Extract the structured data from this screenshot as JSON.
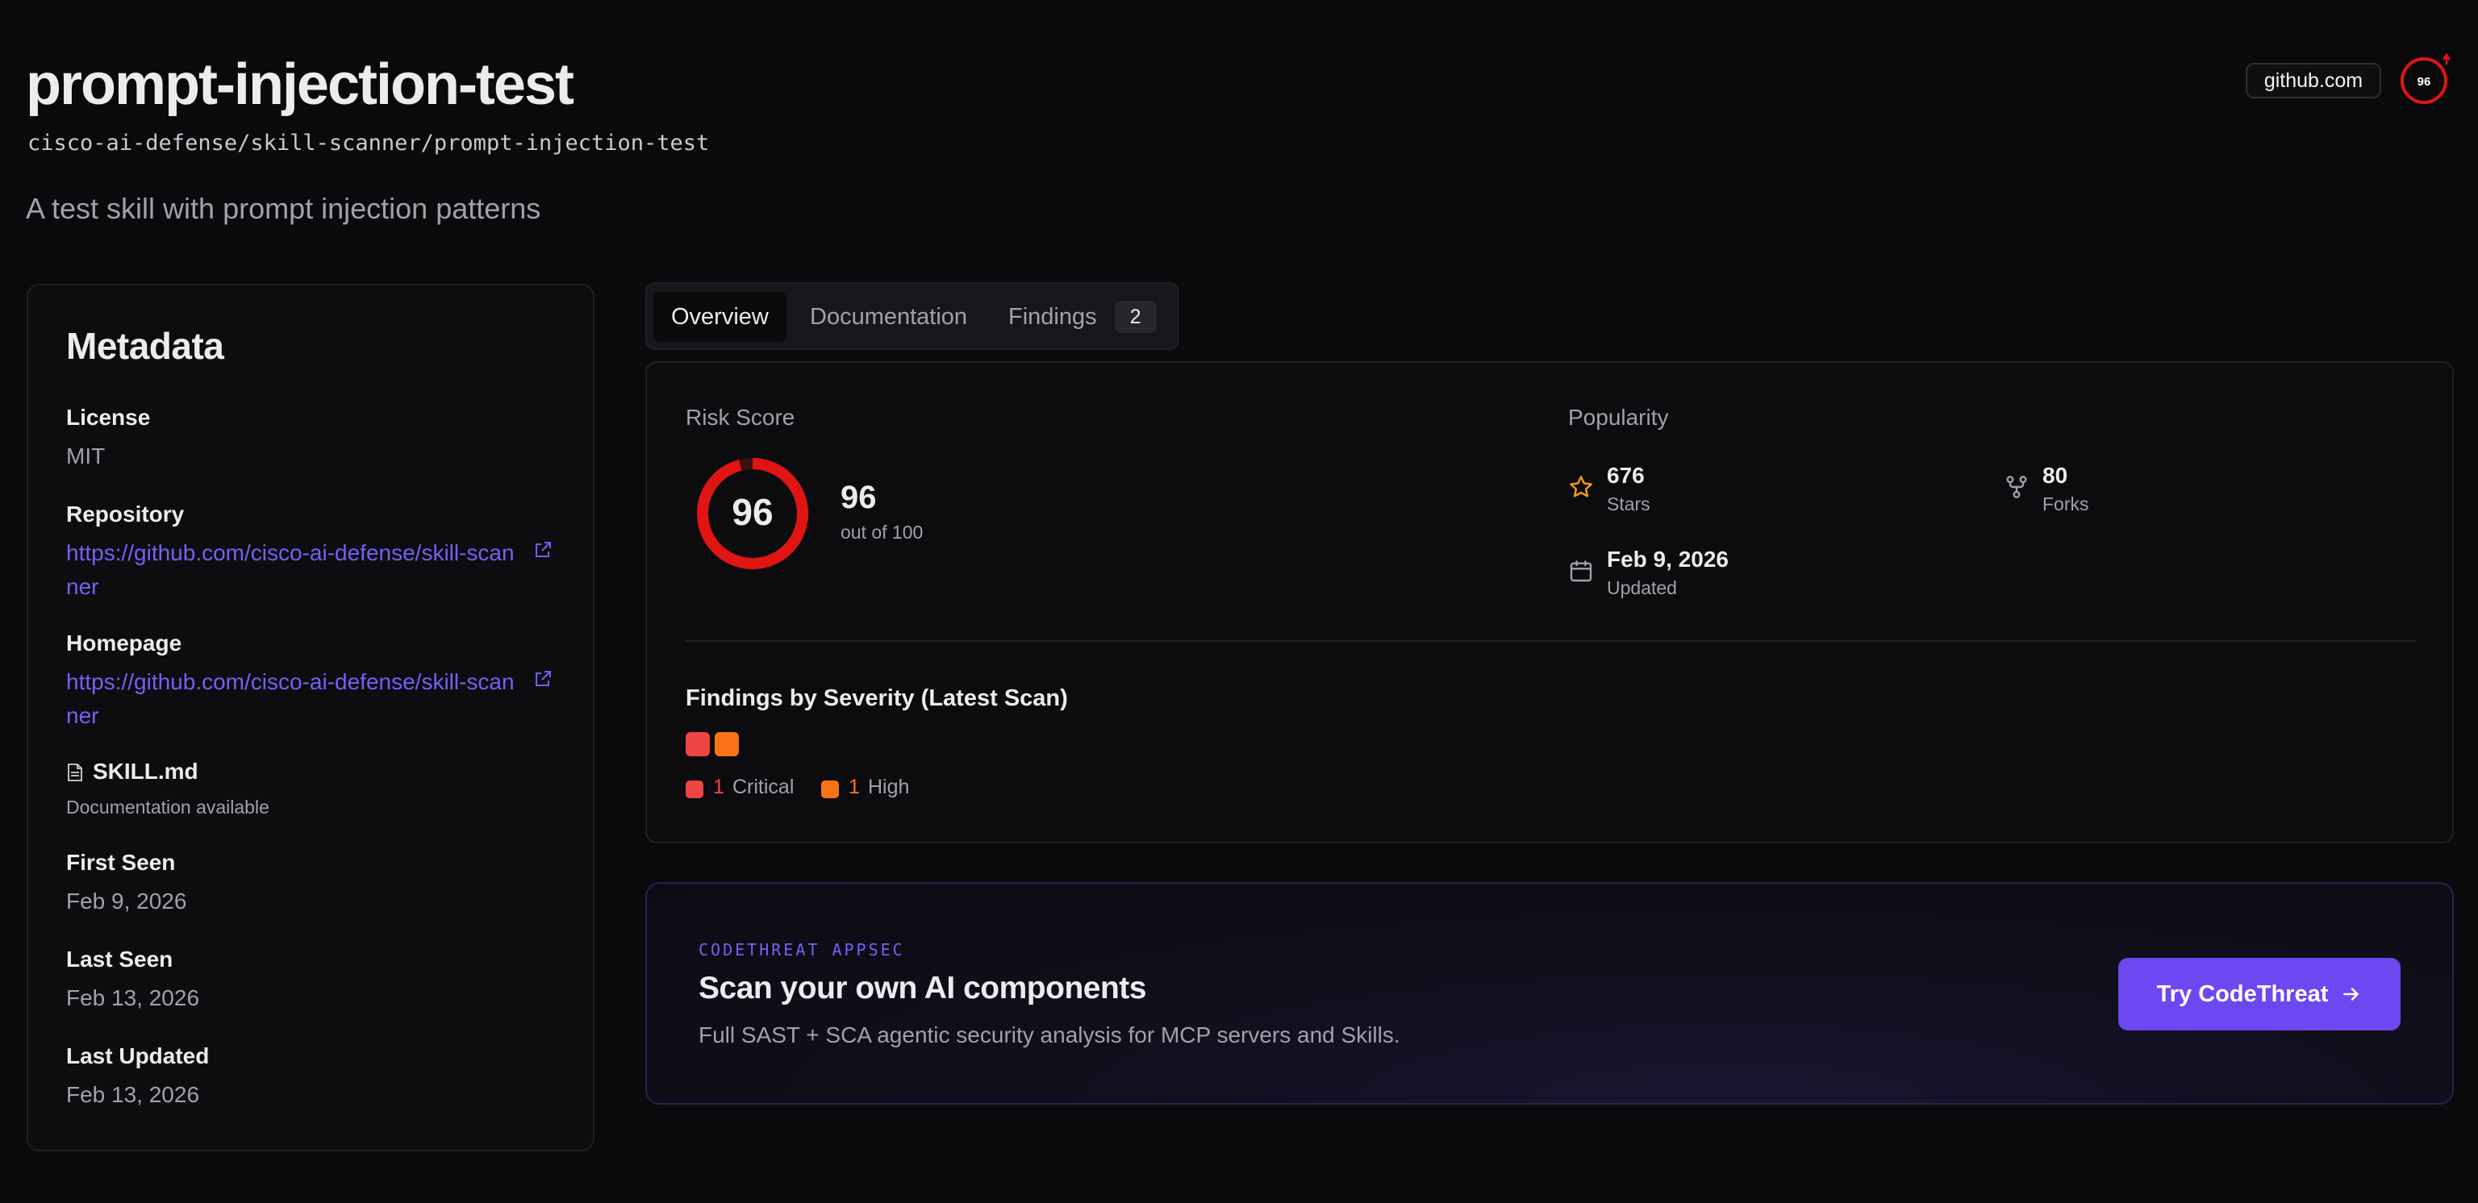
{
  "header": {
    "title": "prompt-injection-test",
    "path": "cisco-ai-defense/skill-scanner/prompt-injection-test",
    "description": "A test skill with prompt injection patterns",
    "source_badge": "github.com",
    "score_badge": "96"
  },
  "metadata": {
    "title": "Metadata",
    "license_label": "License",
    "license_value": "MIT",
    "repository_label": "Repository",
    "repository_url": "https://github.com/cisco-ai-defense/skill-scanner",
    "homepage_label": "Homepage",
    "homepage_url": "https://github.com/cisco-ai-defense/skill-scanner",
    "skill_file": "SKILL.md",
    "skill_file_note": "Documentation available",
    "first_seen_label": "First Seen",
    "first_seen_value": "Feb 9, 2026",
    "last_seen_label": "Last Seen",
    "last_seen_value": "Feb 13, 2026",
    "last_updated_label": "Last Updated",
    "last_updated_value": "Feb 13, 2026"
  },
  "tabs": [
    {
      "label": "Overview",
      "active": true
    },
    {
      "label": "Documentation",
      "active": false
    },
    {
      "label": "Findings",
      "count": "2",
      "active": false
    }
  ],
  "overview": {
    "risk_label": "Risk Score",
    "risk_value": "96",
    "risk_sub": "out of 100",
    "risk_fraction": 0.96,
    "popularity_label": "Popularity",
    "stars_value": "676",
    "stars_label": "Stars",
    "forks_value": "80",
    "forks_label": "Forks",
    "updated_value": "Feb 9, 2026",
    "updated_label": "Updated",
    "severity_title": "Findings by Severity (Latest Scan)",
    "severity": [
      {
        "count": "1",
        "label": "Critical",
        "color": "#ef4444"
      },
      {
        "count": "1",
        "label": "High",
        "color": "#f97316"
      }
    ]
  },
  "promo": {
    "eyebrow": "CODETHREAT APPSEC",
    "title": "Scan your own AI components",
    "subtitle": "Full SAST + SCA agentic security analysis for MCP servers and Skills.",
    "button_label": "Try CodeThreat"
  },
  "colors": {
    "accent": "#7c5cf6",
    "risk": "#e11414",
    "critical": "#ef4444",
    "high": "#f97316",
    "star": "#f59e0b"
  }
}
